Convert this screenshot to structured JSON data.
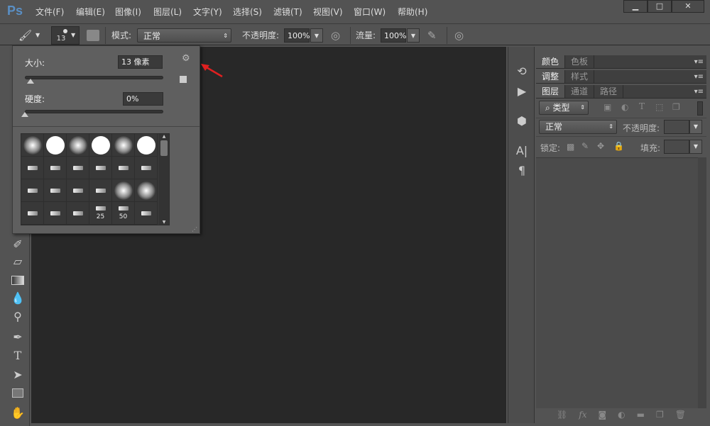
{
  "app": {
    "logo": "Ps"
  },
  "menu": [
    "文件(F)",
    "编辑(E)",
    "图像(I)",
    "图层(L)",
    "文字(Y)",
    "选择(S)",
    "滤镜(T)",
    "视图(V)",
    "窗口(W)",
    "帮助(H)"
  ],
  "window_controls": {
    "minimize": "▁",
    "maximize": "□",
    "close": "✕"
  },
  "options": {
    "brush_size": "13",
    "mode_label": "模式:",
    "mode_value": "正常",
    "opacity_label": "不透明度:",
    "opacity_value": "100%",
    "flow_label": "流量:",
    "flow_value": "100%"
  },
  "brush_popup": {
    "size_label": "大小:",
    "size_value": "13 像素",
    "hardness_label": "硬度:",
    "hardness_value": "0%",
    "size_fraction": 0.04,
    "hardness_fraction": 0.0,
    "presets": [
      [
        "soft",
        ""
      ],
      [
        "hard",
        ""
      ],
      [
        "soft",
        ""
      ],
      [
        "hard",
        ""
      ],
      [
        "soft",
        ""
      ],
      [
        "hard",
        ""
      ],
      [
        "tip",
        ""
      ],
      [
        "tip",
        ""
      ],
      [
        "tip",
        ""
      ],
      [
        "tip",
        ""
      ],
      [
        "tip",
        ""
      ],
      [
        "tip",
        ""
      ],
      [
        "tip",
        ""
      ],
      [
        "tip",
        ""
      ],
      [
        "tip",
        ""
      ],
      [
        "tip",
        ""
      ],
      [
        "soft",
        ""
      ],
      [
        "soft",
        ""
      ],
      [
        "tip",
        ""
      ],
      [
        "tip",
        ""
      ],
      [
        "tip",
        ""
      ],
      [
        "tip",
        "25"
      ],
      [
        "tip",
        "50"
      ],
      [
        "tip",
        ""
      ]
    ]
  },
  "panels": {
    "row1": [
      "颜色",
      "色板"
    ],
    "row2": [
      "调整",
      "样式"
    ],
    "row3": [
      "图层",
      "通道",
      "路径"
    ],
    "filter_label": "类型",
    "blend_mode": "正常",
    "opacity_label": "不透明度:",
    "lock_label": "锁定:",
    "fill_label": "填充:"
  },
  "colors": {
    "accent": "#5a8fc4",
    "canvas": "#282828",
    "annotation_arrow": "#e02020"
  }
}
